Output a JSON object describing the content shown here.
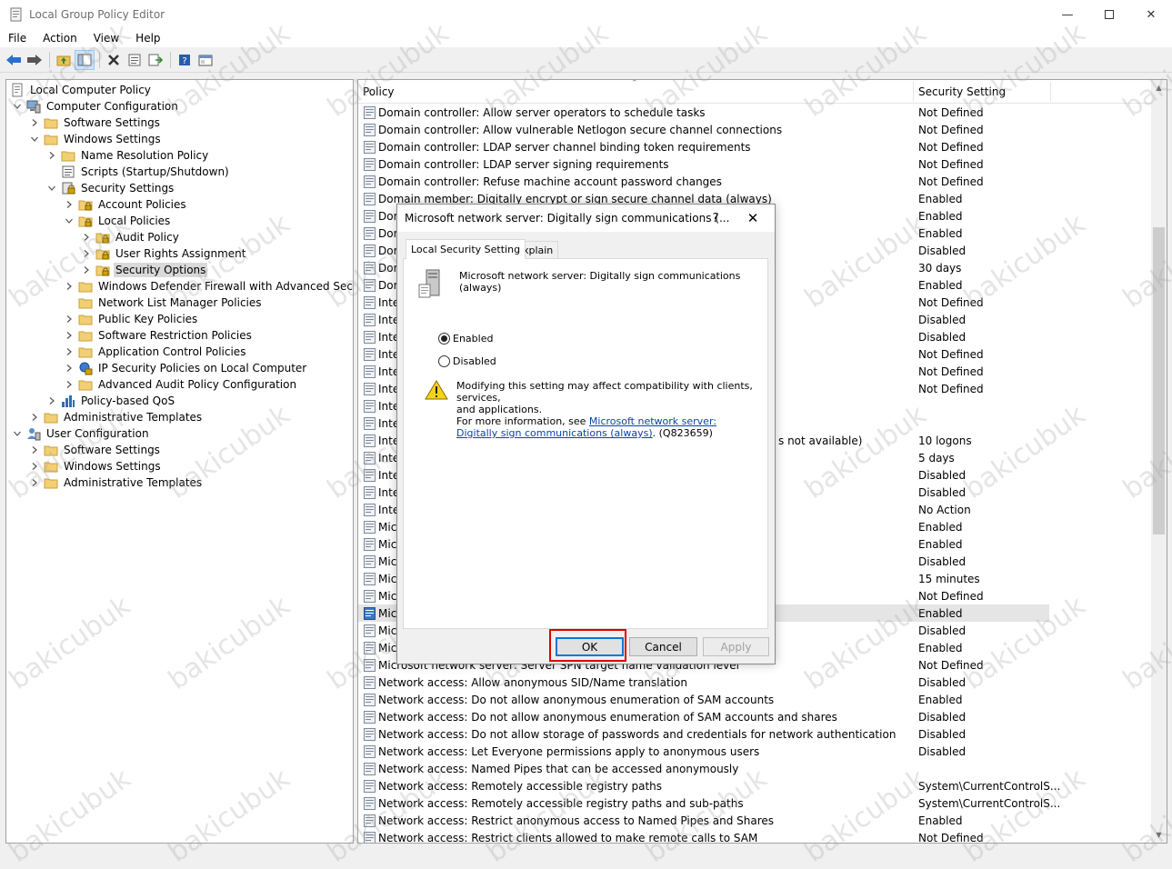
{
  "window": {
    "title": "Local Group Policy Editor"
  },
  "menu": [
    "File",
    "Action",
    "View",
    "Help"
  ],
  "toolbar_icons": [
    "back-arrow-icon",
    "forward-arrow-icon",
    "up-folder-icon",
    "show-hide-tree-icon",
    "delete-icon",
    "properties-icon",
    "export-list-icon",
    "help-icon",
    "console-icon"
  ],
  "tree": [
    {
      "label": "Local Computer Policy",
      "level": 0,
      "chev": "none",
      "icon": "computer-policy-icon"
    },
    {
      "label": "Computer Configuration",
      "level": 0,
      "chev": "down",
      "icon": "computer-icon"
    },
    {
      "label": "Software Settings",
      "level": 1,
      "chev": "right",
      "icon": "folder-icon"
    },
    {
      "label": "Windows Settings",
      "level": 1,
      "chev": "down",
      "icon": "folder-icon"
    },
    {
      "label": "Name Resolution Policy",
      "level": 2,
      "chev": "right",
      "icon": "folder-icon"
    },
    {
      "label": "Scripts (Startup/Shutdown)",
      "level": 2,
      "chev": "none",
      "icon": "scripts-icon"
    },
    {
      "label": "Security Settings",
      "level": 2,
      "chev": "down",
      "icon": "security-settings-icon"
    },
    {
      "label": "Account Policies",
      "level": 3,
      "chev": "right",
      "icon": "lock-folder-icon"
    },
    {
      "label": "Local Policies",
      "level": 3,
      "chev": "down",
      "icon": "lock-folder-icon"
    },
    {
      "label": "Audit Policy",
      "level": 4,
      "chev": "right",
      "icon": "lock-folder-icon"
    },
    {
      "label": "User Rights Assignment",
      "level": 4,
      "chev": "right",
      "icon": "lock-folder-icon"
    },
    {
      "label": "Security Options",
      "level": 4,
      "chev": "right",
      "icon": "lock-folder-icon",
      "selected": true
    },
    {
      "label": "Windows Defender Firewall with Advanced Security",
      "level": 3,
      "chev": "right",
      "icon": "folder-icon"
    },
    {
      "label": "Network List Manager Policies",
      "level": 3,
      "chev": "none",
      "icon": "folder-icon"
    },
    {
      "label": "Public Key Policies",
      "level": 3,
      "chev": "right",
      "icon": "folder-icon"
    },
    {
      "label": "Software Restriction Policies",
      "level": 3,
      "chev": "right",
      "icon": "folder-icon"
    },
    {
      "label": "Application Control Policies",
      "level": 3,
      "chev": "right",
      "icon": "folder-icon"
    },
    {
      "label": "IP Security Policies on Local Computer",
      "level": 3,
      "chev": "right",
      "icon": "ip-security-icon"
    },
    {
      "label": "Advanced Audit Policy Configuration",
      "level": 3,
      "chev": "right",
      "icon": "folder-icon"
    },
    {
      "label": "Policy-based QoS",
      "level": 2,
      "chev": "right",
      "icon": "qos-chart-icon"
    },
    {
      "label": "Administrative Templates",
      "level": 1,
      "chev": "right",
      "icon": "folder-icon"
    },
    {
      "label": "User Configuration",
      "level": 0,
      "chev": "down",
      "icon": "user-icon"
    },
    {
      "label": "Software Settings",
      "level": 1,
      "chev": "right",
      "icon": "folder-icon"
    },
    {
      "label": "Windows Settings",
      "level": 1,
      "chev": "right",
      "icon": "folder-icon"
    },
    {
      "label": "Administrative Templates",
      "level": 1,
      "chev": "right",
      "icon": "folder-icon"
    }
  ],
  "list": {
    "header_policy": "Policy",
    "header_setting": "Security Setting",
    "rows": [
      {
        "policy": "Domain controller: Allow server operators to schedule tasks",
        "setting": "Not Defined"
      },
      {
        "policy": "Domain controller: Allow vulnerable Netlogon secure channel connections",
        "setting": "Not Defined"
      },
      {
        "policy": "Domain controller: LDAP server channel binding token requirements",
        "setting": "Not Defined"
      },
      {
        "policy": "Domain controller: LDAP server signing requirements",
        "setting": "Not Defined"
      },
      {
        "policy": "Domain controller: Refuse machine account password changes",
        "setting": "Not Defined"
      },
      {
        "policy": "Domain member: Digitally encrypt or sign secure channel data (always)",
        "setting": "Enabled"
      },
      {
        "policy": "Dom",
        "setting": "Enabled"
      },
      {
        "policy": "Dom",
        "setting": "Enabled"
      },
      {
        "policy": "Dom",
        "setting": "Disabled"
      },
      {
        "policy": "Dom",
        "setting": "30 days"
      },
      {
        "policy": "Dom",
        "setting": "Enabled"
      },
      {
        "policy": "Inte",
        "setting": "Not Defined"
      },
      {
        "policy": "Inte",
        "setting": "Disabled"
      },
      {
        "policy": "Inte",
        "setting": "Disabled"
      },
      {
        "policy": "Inte",
        "setting": "Not Defined"
      },
      {
        "policy": "Inte",
        "setting": "Not Defined"
      },
      {
        "policy": "Inte",
        "setting": "Not Defined"
      },
      {
        "policy": "Inte",
        "setting": ""
      },
      {
        "policy": "Inte",
        "setting": ""
      },
      {
        "policy": "Inte",
        "setting": "10 logons",
        "tail": "s not available)"
      },
      {
        "policy": "Inte",
        "setting": "5 days"
      },
      {
        "policy": "Inte",
        "setting": "Disabled"
      },
      {
        "policy": "Inte",
        "setting": "Disabled"
      },
      {
        "policy": "Inte",
        "setting": "No Action"
      },
      {
        "policy": "Mic",
        "setting": "Enabled"
      },
      {
        "policy": "Mic",
        "setting": "Enabled"
      },
      {
        "policy": "Mic",
        "setting": "Disabled"
      },
      {
        "policy": "Mic",
        "setting": "15 minutes"
      },
      {
        "policy": "Mic",
        "setting": "Not Defined"
      },
      {
        "policy": "Mic",
        "setting": "Enabled",
        "selected": true
      },
      {
        "policy": "Mic",
        "setting": "Disabled"
      },
      {
        "policy": "Mic",
        "setting": "Enabled"
      },
      {
        "policy": "Microsoft network server: Server SPN target name validation level",
        "setting": "Not Defined"
      },
      {
        "policy": "Network access: Allow anonymous SID/Name translation",
        "setting": "Disabled"
      },
      {
        "policy": "Network access: Do not allow anonymous enumeration of SAM accounts",
        "setting": "Enabled"
      },
      {
        "policy": "Network access: Do not allow anonymous enumeration of SAM accounts and shares",
        "setting": "Disabled"
      },
      {
        "policy": "Network access: Do not allow storage of passwords and credentials for network authentication",
        "setting": "Disabled"
      },
      {
        "policy": "Network access: Let Everyone permissions apply to anonymous users",
        "setting": "Disabled"
      },
      {
        "policy": "Network access: Named Pipes that can be accessed anonymously",
        "setting": ""
      },
      {
        "policy": "Network access: Remotely accessible registry paths",
        "setting": "System\\CurrentControlS..."
      },
      {
        "policy": "Network access: Remotely accessible registry paths and sub-paths",
        "setting": "System\\CurrentControlS..."
      },
      {
        "policy": "Network access: Restrict anonymous access to Named Pipes and Shares",
        "setting": "Enabled"
      },
      {
        "policy": "Network access: Restrict clients allowed to make remote calls to SAM",
        "setting": "Not Defined"
      }
    ]
  },
  "dialog": {
    "title": "Microsoft network server: Digitally sign communications (...",
    "help": "?",
    "close": "✕",
    "tabs": [
      "Local Security Setting",
      "Explain"
    ],
    "policy_name": "Microsoft network server: Digitally sign communications (always)",
    "options": [
      {
        "label": "Enabled",
        "checked": true
      },
      {
        "label": "Disabled",
        "checked": false
      }
    ],
    "warning_line1": "Modifying this setting may affect compatibility with clients, services,",
    "warning_line2": "and applications.",
    "warning_info_prefix": "For more information, see ",
    "warning_link": "Microsoft network server: Digitally sign communications (always)",
    "warning_kb": ". (Q823659)",
    "buttons": {
      "ok": "OK",
      "cancel": "Cancel",
      "apply": "Apply"
    }
  },
  "watermark": "bakicubuk",
  "colors": {
    "highlight_box": "#e00000",
    "link": "#0645ad",
    "selection": "#d9d9d9"
  }
}
